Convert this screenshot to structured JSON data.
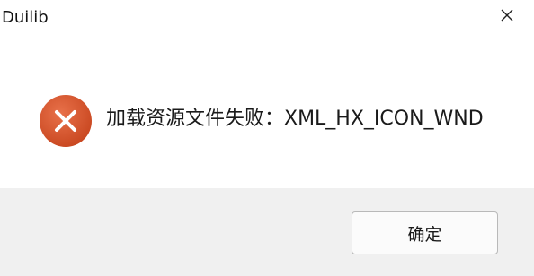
{
  "window": {
    "title": "Duilib"
  },
  "dialog": {
    "message": "加载资源文件失败：XML_HX_ICON_WND",
    "ok_label": "确定"
  },
  "icons": {
    "close": "close-icon",
    "error": "error-icon"
  },
  "colors": {
    "error_icon": "#d4532b",
    "footer_bg": "#f0f0f0",
    "content_bg": "#ffffff"
  }
}
